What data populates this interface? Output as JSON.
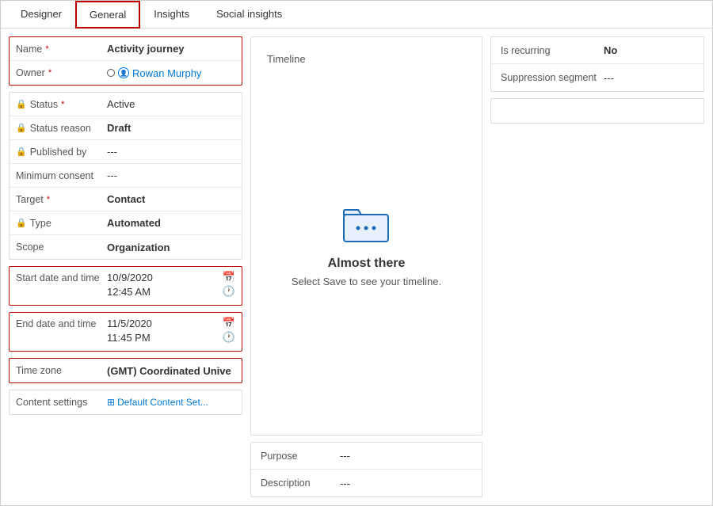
{
  "tabs": [
    {
      "id": "designer",
      "label": "Designer",
      "active": false
    },
    {
      "id": "general",
      "label": "General",
      "active": true
    },
    {
      "id": "insights",
      "label": "Insights",
      "active": false
    },
    {
      "id": "social-insights",
      "label": "Social insights",
      "active": false
    }
  ],
  "form": {
    "name": {
      "label": "Name",
      "value": "Activity journey",
      "required": true
    },
    "owner": {
      "label": "Owner",
      "value": "Rowan Murphy",
      "required": true
    },
    "status": {
      "label": "Status",
      "value": "Active",
      "required": true
    },
    "status_reason": {
      "label": "Status reason",
      "value": "Draft"
    },
    "published_by": {
      "label": "Published by",
      "value": "---"
    },
    "minimum_consent": {
      "label": "Minimum consent",
      "value": "---"
    },
    "target": {
      "label": "Target",
      "value": "Contact",
      "required": true
    },
    "type": {
      "label": "Type",
      "value": "Automated"
    },
    "scope": {
      "label": "Scope",
      "value": "Organization"
    }
  },
  "dates": {
    "start": {
      "label": "Start date and time",
      "date": "10/9/2020",
      "time": "12:45 AM"
    },
    "end": {
      "label": "End date and time",
      "date": "11/5/2020",
      "time": "11:45 PM"
    },
    "timezone": {
      "label": "Time zone",
      "value": "(GMT) Coordinated Unive"
    },
    "content_settings": {
      "label": "Content settings",
      "value": "Default Content Set..."
    }
  },
  "timeline": {
    "label": "Timeline",
    "heading": "Almost there",
    "subtext": "Select Save to see your timeline."
  },
  "purpose": {
    "purpose_label": "Purpose",
    "purpose_value": "---",
    "description_label": "Description",
    "description_value": "---"
  },
  "right": {
    "is_recurring_label": "Is recurring",
    "is_recurring_value": "No",
    "suppression_label": "Suppression segment",
    "suppression_value": "---"
  }
}
